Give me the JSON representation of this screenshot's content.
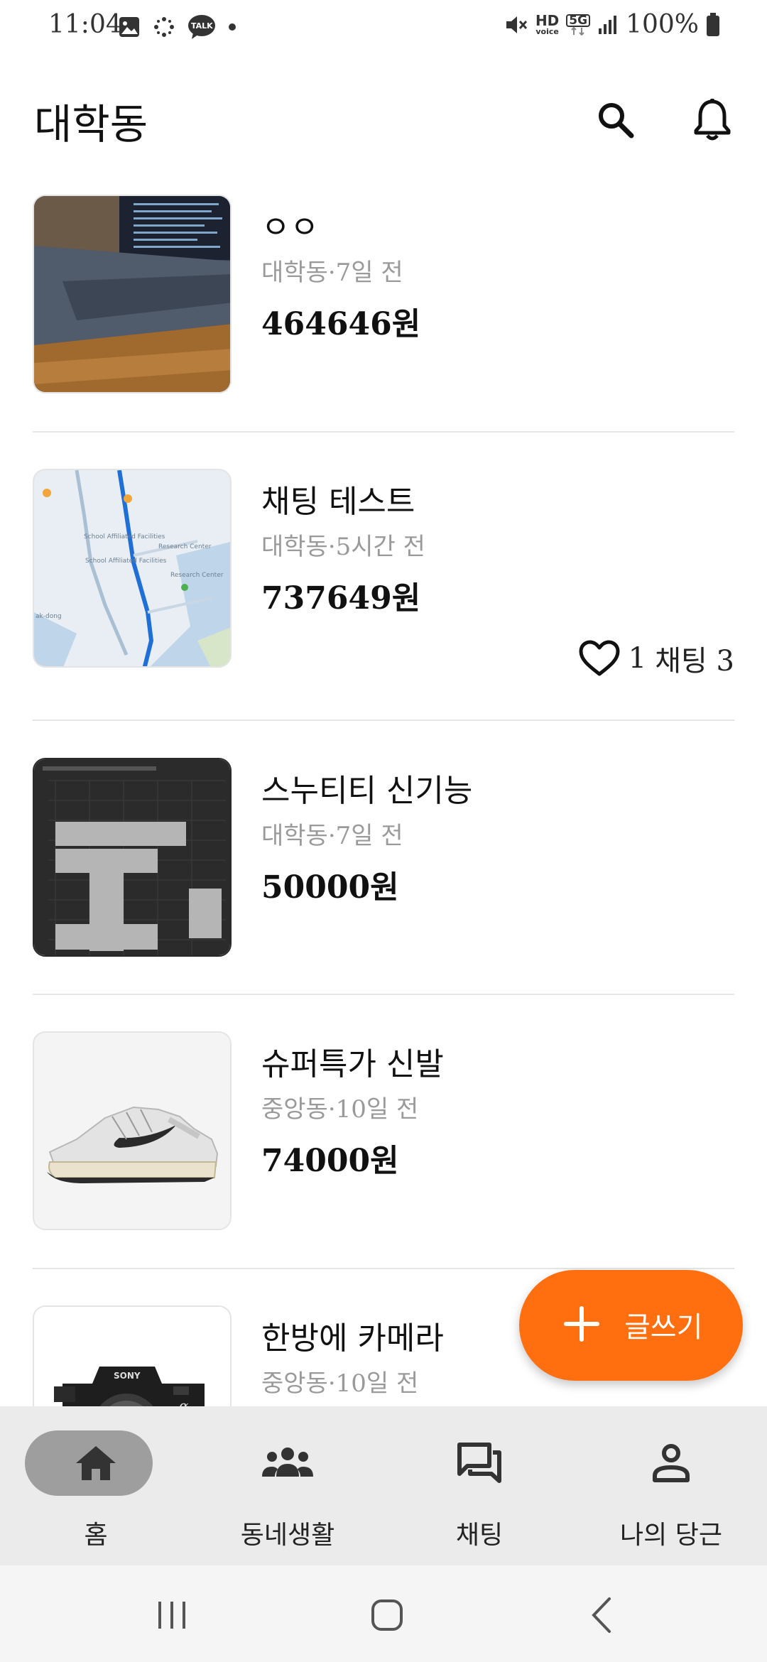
{
  "status_bar": {
    "time": "11:04",
    "battery_percent": "100%",
    "notification_icons": [
      "image-icon",
      "snow-icon",
      "kakaotalk-icon",
      "dot-icon"
    ],
    "talk_badge": "TALK",
    "hd_badge": "HD",
    "voice_badge": "voice",
    "network_badge": "5G",
    "system_icons": [
      "mute-icon",
      "hd-voice-icon",
      "5g-icon",
      "signal-icon",
      "battery-icon"
    ]
  },
  "header": {
    "title": "대학동",
    "actions": [
      "search-icon",
      "bell-icon"
    ]
  },
  "listings": [
    {
      "title": "ㅇㅇ",
      "meta": "대학동·7일 전",
      "price": "464646원",
      "image": "laptop-photo"
    },
    {
      "title": "채팅 테스트",
      "meta": "대학동·5시간 전",
      "price": "737649원",
      "image": "map-photo",
      "likes": "1",
      "chats_label": "채팅 3",
      "map_labels": [
        "School Affiliated Facilities",
        "School Affiliated Facilities",
        "Research Center",
        "Research Center",
        "ak-dong"
      ]
    },
    {
      "title": "스누티티 신기능",
      "meta": "대학동·7일 전",
      "price": "50000원",
      "image": "timetable-screenshot"
    },
    {
      "title": "슈퍼특가 신발",
      "meta": "중앙동·10일 전",
      "price": "74000원",
      "image": "sneaker-photo"
    },
    {
      "title": "한방에 카메라",
      "meta": "중앙동·10일 전",
      "image": "camera-photo",
      "camera_brand": "SONY",
      "camera_mark": "α"
    }
  ],
  "fab": {
    "label": "글쓰기",
    "color": "#ff6f0f"
  },
  "bottom_nav": {
    "items": [
      {
        "label": "홈",
        "icon": "home-icon",
        "active": true
      },
      {
        "label": "동네생활",
        "icon": "people-icon",
        "active": false
      },
      {
        "label": "채팅",
        "icon": "chat-icon",
        "active": false
      },
      {
        "label": "나의 당근",
        "icon": "person-icon",
        "active": false
      }
    ]
  },
  "system_nav": {
    "buttons": [
      "recents-icon",
      "home-circle-icon",
      "back-icon"
    ]
  }
}
